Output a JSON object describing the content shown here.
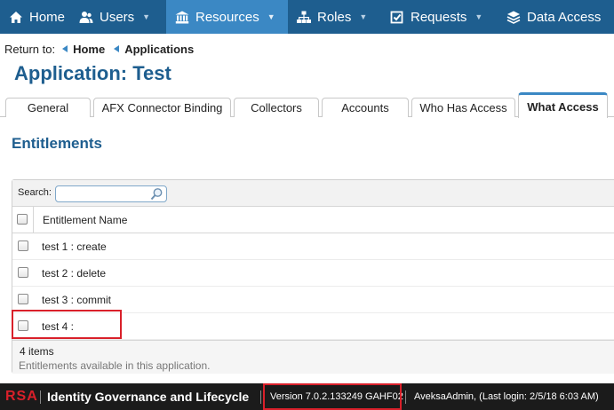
{
  "nav": {
    "items": [
      {
        "label": "Home",
        "icon": "home-icon",
        "active": false,
        "caret": false
      },
      {
        "label": "Users",
        "icon": "users-icon",
        "active": false,
        "caret": true
      },
      {
        "label": "Resources",
        "icon": "bank-icon",
        "active": true,
        "caret": true
      },
      {
        "label": "Roles",
        "icon": "sitemap-icon",
        "active": false,
        "caret": true
      },
      {
        "label": "Requests",
        "icon": "checklist-icon",
        "active": false,
        "caret": true
      },
      {
        "label": "Data Access",
        "icon": "stack-icon",
        "active": false,
        "caret": false
      }
    ]
  },
  "breadcrumb": {
    "prefix": "Return to:",
    "links": [
      "Home",
      "Applications"
    ]
  },
  "page": {
    "title": "Application: Test"
  },
  "tabs": [
    {
      "label": "General",
      "active": false
    },
    {
      "label": "AFX Connector Binding",
      "active": false
    },
    {
      "label": "Collectors",
      "active": false
    },
    {
      "label": "Accounts",
      "active": false
    },
    {
      "label": "Who Has Access",
      "active": false
    },
    {
      "label": "What Access",
      "active": true
    }
  ],
  "section": {
    "title": "Entitlements"
  },
  "grid": {
    "search_label": "Search:",
    "search_value": "",
    "column_header": "Entitlement Name",
    "rows": [
      "test 1 : create",
      "test 2 : delete",
      "test 3 : commit",
      "test 4 :"
    ],
    "count_text": "4 items",
    "description": "Entitlements available in this application."
  },
  "footer": {
    "logo": "RSA",
    "product": "Identity Governance and Lifecycle",
    "version": "Version 7.0.2.133249 GAHF02",
    "user": "AveksaAdmin,",
    "last_login": "(Last login: 2/5/18 6:03 AM)"
  },
  "colors": {
    "nav_bg": "#1e5e8f",
    "nav_active": "#3b88c4",
    "title_blue": "#1e5e8f",
    "highlight_red": "#d9202a",
    "footer_bg": "#1b1b1b"
  }
}
